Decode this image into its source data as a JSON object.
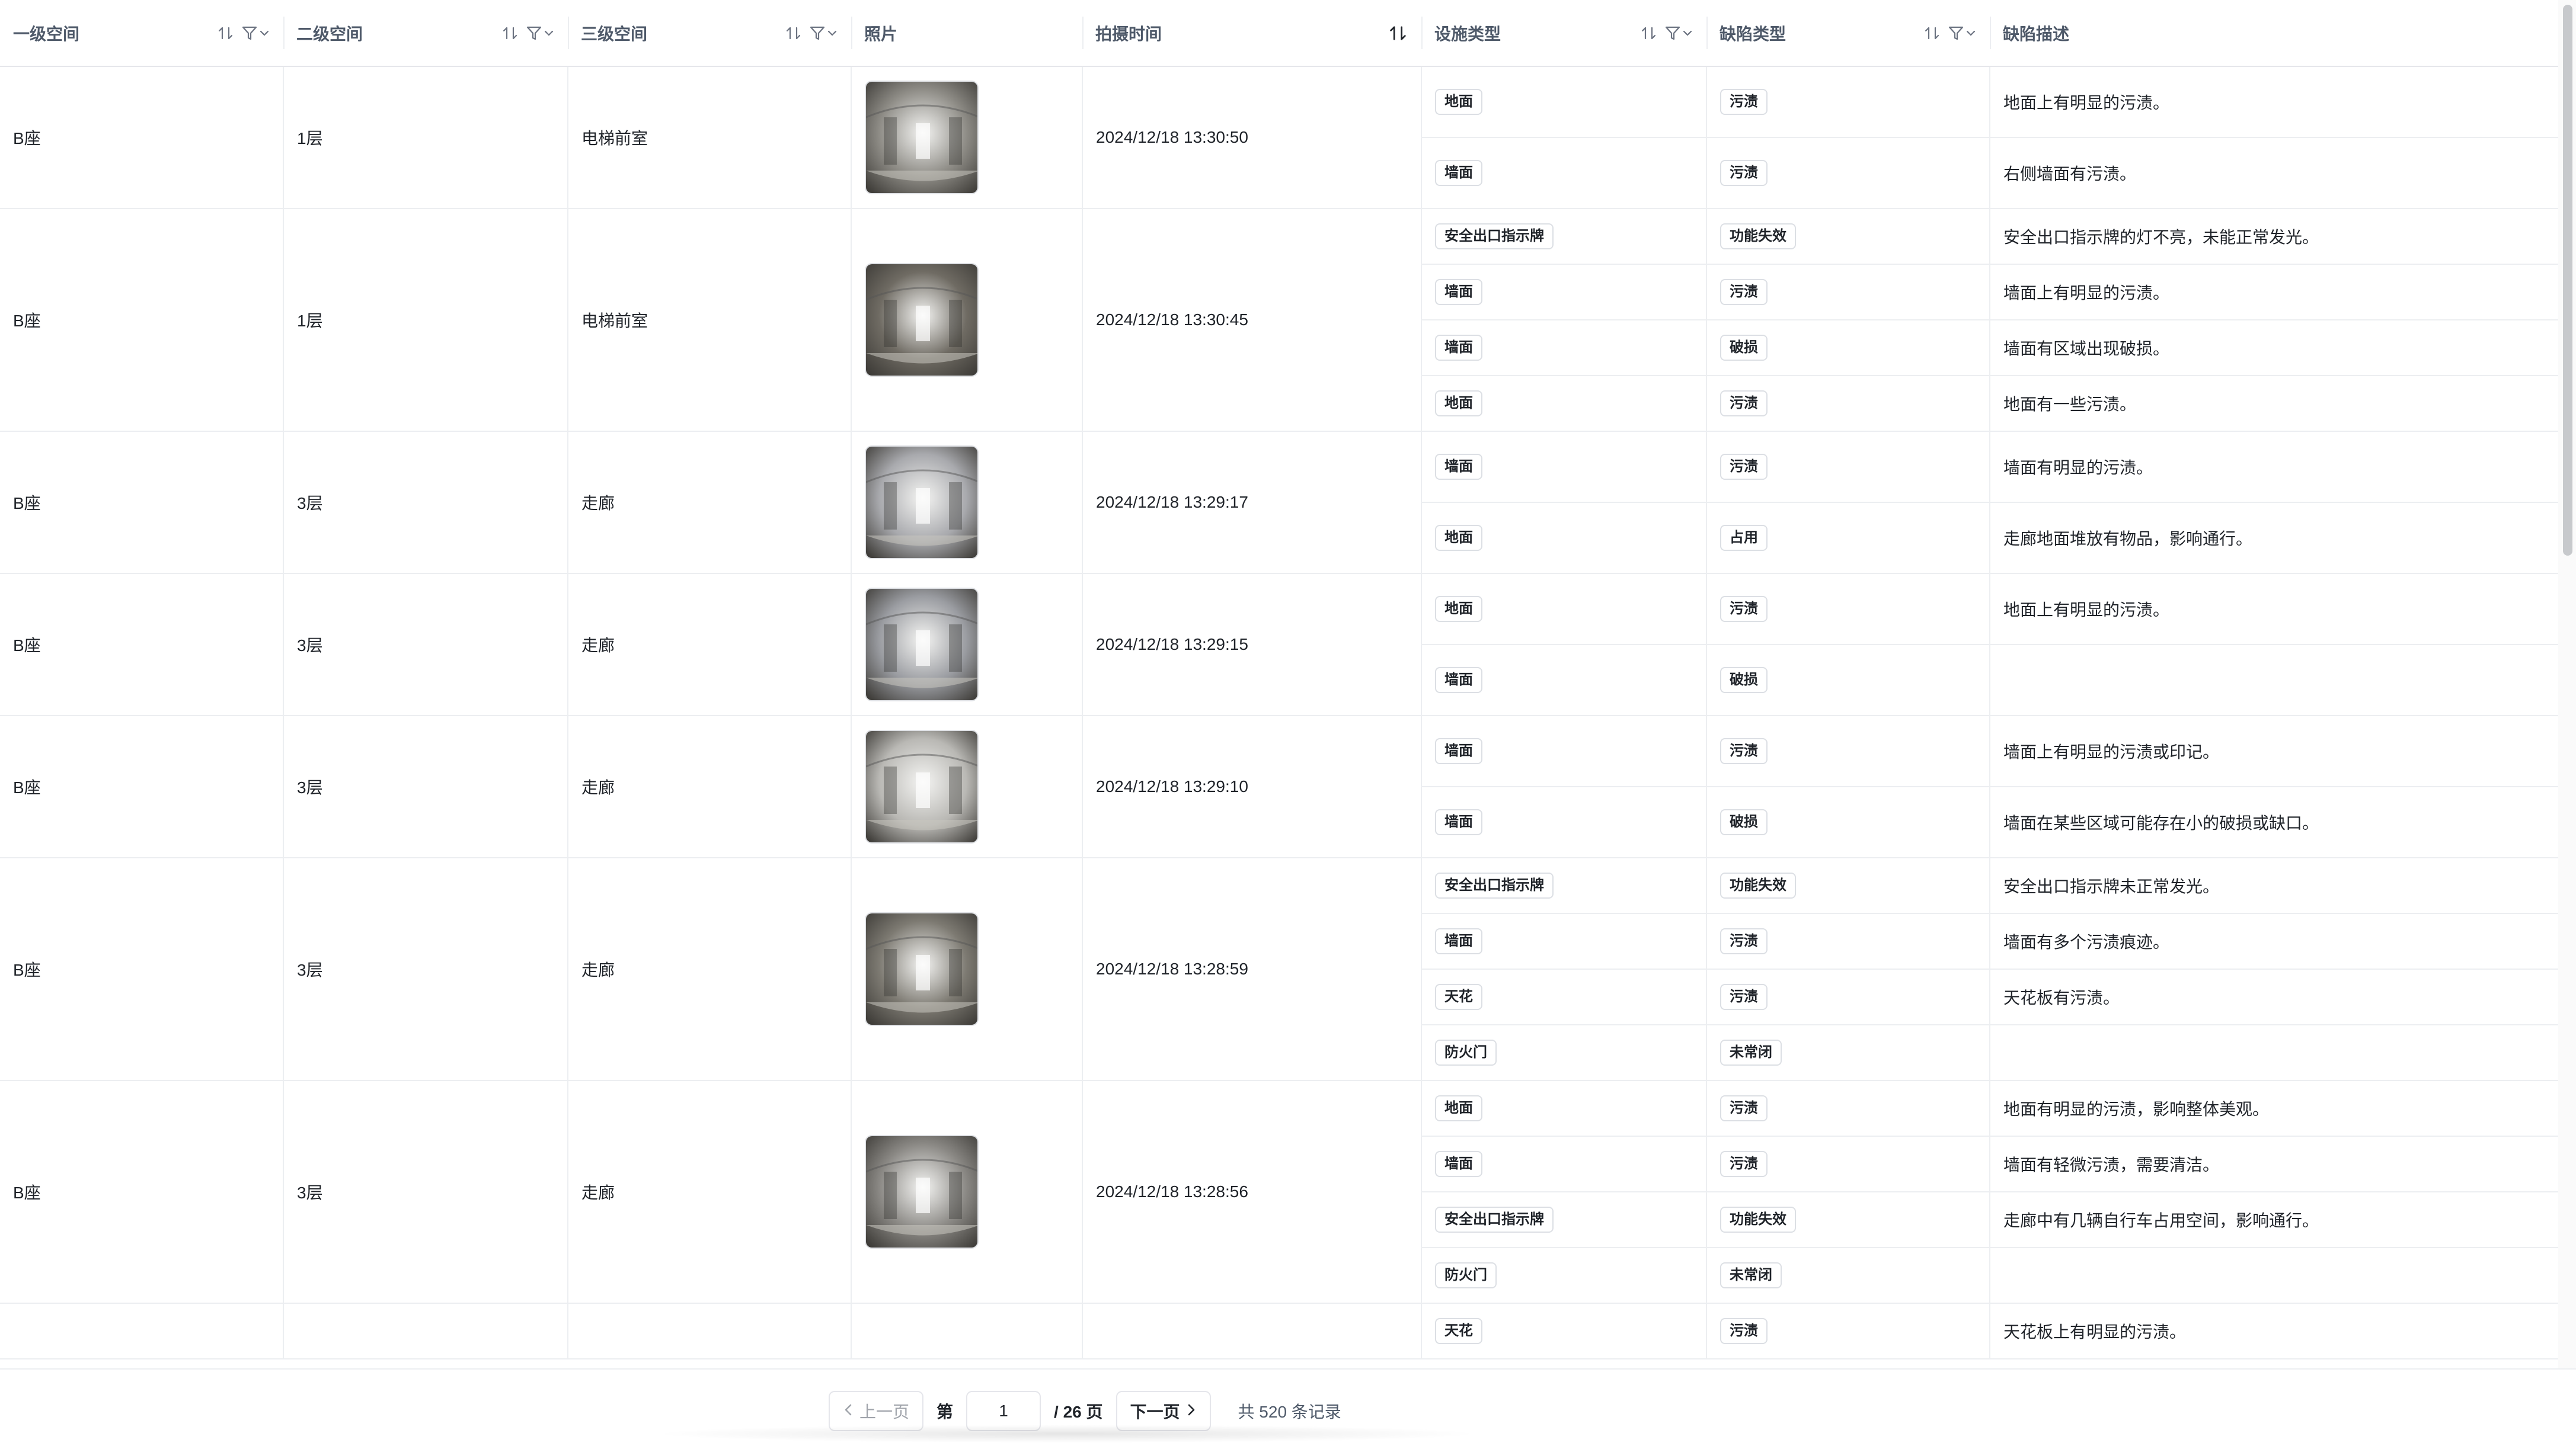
{
  "columns": {
    "l1": "一级空间",
    "l2": "二级空间",
    "l3": "三级空间",
    "photo": "照片",
    "time": "拍摄时间",
    "facility": "设施类型",
    "defect": "缺陷类型",
    "desc": "缺陷描述"
  },
  "rows": [
    {
      "l1": "B座",
      "l2": "1层",
      "l3": "电梯前室",
      "time": "2024/12/18 13:30:50",
      "photo_icon": "panorama-thumbnail",
      "defects": [
        {
          "facility": "地面",
          "type": "污渍",
          "desc": "地面上有明显的污渍。"
        },
        {
          "facility": "墙面",
          "type": "污渍",
          "desc": "右侧墙面有污渍。"
        }
      ]
    },
    {
      "l1": "B座",
      "l2": "1层",
      "l3": "电梯前室",
      "time": "2024/12/18 13:30:45",
      "photo_icon": "panorama-thumbnail",
      "defects": [
        {
          "facility": "安全出口指示牌",
          "type": "功能失效",
          "desc": "安全出口指示牌的灯不亮，未能正常发光。"
        },
        {
          "facility": "墙面",
          "type": "污渍",
          "desc": "墙面上有明显的污渍。"
        },
        {
          "facility": "墙面",
          "type": "破损",
          "desc": "墙面有区域出现破损。"
        },
        {
          "facility": "地面",
          "type": "污渍",
          "desc": "地面有一些污渍。"
        }
      ]
    },
    {
      "l1": "B座",
      "l2": "3层",
      "l3": "走廊",
      "time": "2024/12/18 13:29:17",
      "photo_icon": "panorama-thumbnail",
      "defects": [
        {
          "facility": "墙面",
          "type": "污渍",
          "desc": "墙面有明显的污渍。"
        },
        {
          "facility": "地面",
          "type": "占用",
          "desc": "走廊地面堆放有物品，影响通行。"
        }
      ]
    },
    {
      "l1": "B座",
      "l2": "3层",
      "l3": "走廊",
      "time": "2024/12/18 13:29:15",
      "photo_icon": "panorama-thumbnail",
      "defects": [
        {
          "facility": "地面",
          "type": "污渍",
          "desc": "地面上有明显的污渍。"
        },
        {
          "facility": "墙面",
          "type": "破损",
          "desc": ""
        }
      ]
    },
    {
      "l1": "B座",
      "l2": "3层",
      "l3": "走廊",
      "time": "2024/12/18 13:29:10",
      "photo_icon": "panorama-thumbnail",
      "defects": [
        {
          "facility": "墙面",
          "type": "污渍",
          "desc": "墙面上有明显的污渍或印记。"
        },
        {
          "facility": "墙面",
          "type": "破损",
          "desc": "墙面在某些区域可能存在小的破损或缺口。"
        }
      ]
    },
    {
      "l1": "B座",
      "l2": "3层",
      "l3": "走廊",
      "time": "2024/12/18 13:28:59",
      "photo_icon": "panorama-thumbnail",
      "defects": [
        {
          "facility": "安全出口指示牌",
          "type": "功能失效",
          "desc": "安全出口指示牌未正常发光。"
        },
        {
          "facility": "墙面",
          "type": "污渍",
          "desc": "墙面有多个污渍痕迹。"
        },
        {
          "facility": "天花",
          "type": "污渍",
          "desc": "天花板有污渍。"
        },
        {
          "facility": "防火门",
          "type": "未常闭",
          "desc": ""
        }
      ]
    },
    {
      "l1": "B座",
      "l2": "3层",
      "l3": "走廊",
      "time": "2024/12/18 13:28:56",
      "photo_icon": "panorama-thumbnail",
      "defects": [
        {
          "facility": "地面",
          "type": "污渍",
          "desc": "地面有明显的污渍，影响整体美观。"
        },
        {
          "facility": "墙面",
          "type": "污渍",
          "desc": "墙面有轻微污渍，需要清洁。"
        },
        {
          "facility": "安全出口指示牌",
          "type": "功能失效",
          "desc": "走廊中有几辆自行车占用空间，影响通行。"
        },
        {
          "facility": "防火门",
          "type": "未常闭",
          "desc": ""
        }
      ]
    },
    {
      "l1": "",
      "l2": "",
      "l3": "",
      "time": "",
      "photo_icon": "",
      "defects": [
        {
          "facility": "天花",
          "type": "污渍",
          "desc": "天花板上有明显的污渍。"
        }
      ]
    }
  ],
  "pagination": {
    "prev_label": "上一页",
    "page_prefix": "第",
    "current_page": "1",
    "page_suffix": "/ 26 页",
    "next_label": "下一页",
    "total_text": "共 520 条记录"
  },
  "colors": {
    "border": "#eceef1",
    "header_text": "#4e5969",
    "tag_border": "#dcdfe4"
  }
}
